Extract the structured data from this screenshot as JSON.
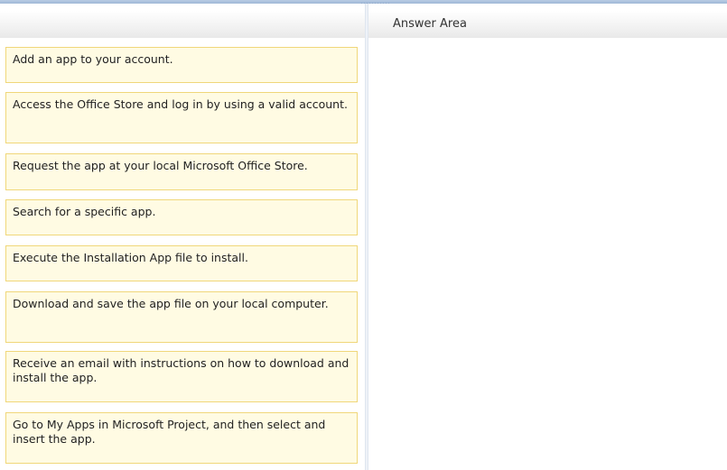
{
  "answer_area": {
    "title": "Answer Area"
  },
  "items": [
    {
      "label": "Add an app to your account."
    },
    {
      "label": "Access the Office Store and log in by using a valid account."
    },
    {
      "label": "Request the app at your local Microsoft Office Store."
    },
    {
      "label": "Search for a specific app."
    },
    {
      "label": "Execute the Installation App file to install."
    },
    {
      "label": "Download and save the app file on your local computer."
    },
    {
      "label": "Receive an email with instructions on how to download and install the app."
    },
    {
      "label": "Go to My Apps in Microsoft Project, and then select and insert the app."
    }
  ]
}
